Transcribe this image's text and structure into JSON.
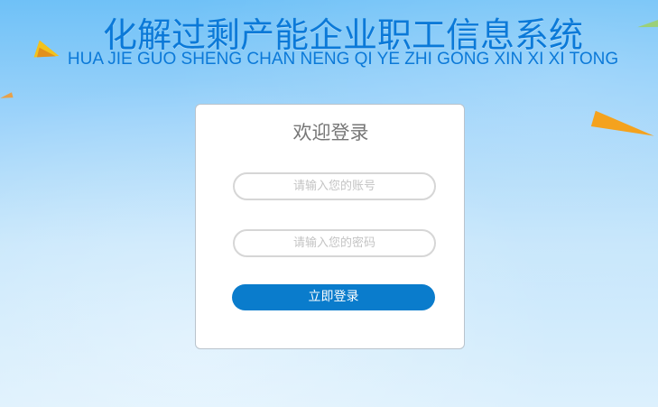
{
  "header": {
    "title": "化解过剩产能企业职工信息系统",
    "subtitle": "HUA JIE GUO SHENG CHAN NENG QI YE ZHI GONG XIN XI XI TONG"
  },
  "login": {
    "title": "欢迎登录",
    "account_placeholder": "请输入您的账号",
    "password_placeholder": "请输入您的密码",
    "submit_label": "立即登录"
  },
  "colors": {
    "title": "#0b79d8",
    "button": "#0a7ccc",
    "background_top": "#6fc1f7",
    "background_bottom": "#dcf0fd"
  }
}
